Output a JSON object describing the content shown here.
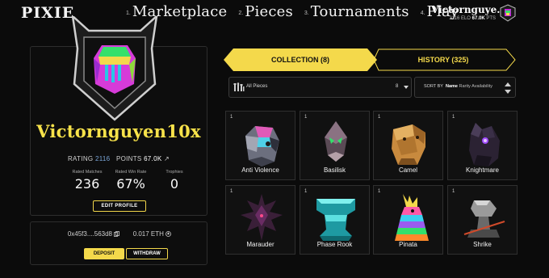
{
  "app": {
    "logo": "PIXIE"
  },
  "nav": [
    {
      "num": "1.",
      "label": "Marketplace"
    },
    {
      "num": "2.",
      "label": "Pieces"
    },
    {
      "num": "3.",
      "label": "Tournaments"
    },
    {
      "num": "4.",
      "label": "Play"
    }
  ],
  "user": {
    "name": "Victornguye...",
    "elo": "2116",
    "elo_unit": "ELO",
    "points": "67.0K",
    "points_unit": "PTS"
  },
  "profile": {
    "name": "Victornguyen10x",
    "rating_label": "RATING",
    "rating": "2116",
    "points_label": "POINTS",
    "points": "67.0K",
    "points_arrow": "↗",
    "stats": [
      {
        "label": "Rated Matches",
        "value": "236"
      },
      {
        "label": "Rated Win Rate",
        "value": "67%"
      },
      {
        "label": "Trophies",
        "value": "0"
      }
    ],
    "edit_label": "EDIT PROFILE"
  },
  "wallet": {
    "address": "0x45f3....563d8",
    "copy_icon": "copy-icon",
    "balance": "0.017 ETH",
    "eth_icon": "eth-icon",
    "deposit_label": "DEPOSIT",
    "withdraw_label": "WITHDRAW"
  },
  "tabs": {
    "collection": "COLLECTION (8)",
    "history": "HISTORY (325)"
  },
  "filters": {
    "pieces_label": "All Pieces",
    "pieces_count": "8",
    "sort_by": "SORT BY",
    "sort_options": [
      "Name",
      "Rarity",
      "Availability"
    ],
    "sort_active": "Name"
  },
  "colors": {
    "accent": "#f4d94b",
    "background": "#0b0b0b",
    "card_border": "#2f2f2f"
  },
  "pieces": [
    {
      "count": "1",
      "name": "Anti Violence",
      "icon": "anti-violence-piece-icon"
    },
    {
      "count": "1",
      "name": "Basilisk",
      "icon": "basilisk-piece-icon"
    },
    {
      "count": "1",
      "name": "Camel",
      "icon": "camel-piece-icon"
    },
    {
      "count": "1",
      "name": "Knightmare",
      "icon": "knightmare-piece-icon"
    },
    {
      "count": "1",
      "name": "Marauder",
      "icon": "marauder-piece-icon"
    },
    {
      "count": "1",
      "name": "Phase Rook",
      "icon": "phase-rook-piece-icon"
    },
    {
      "count": "1",
      "name": "Pinata",
      "icon": "pinata-piece-icon"
    },
    {
      "count": "1",
      "name": "Shrike",
      "icon": "shrike-piece-icon"
    }
  ]
}
